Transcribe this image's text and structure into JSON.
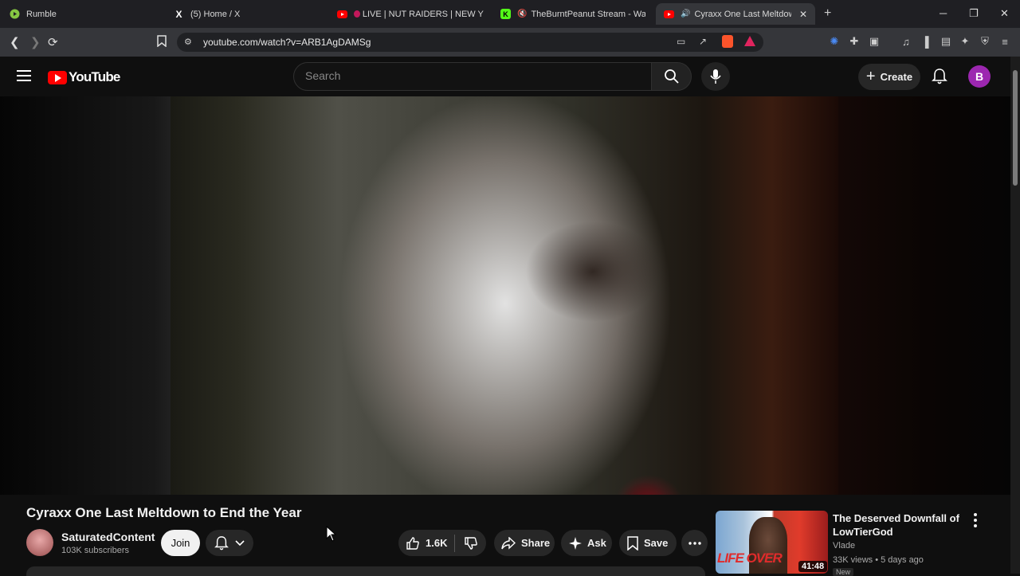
{
  "browser": {
    "tabs": [
      {
        "label": "Rumble",
        "icon": "rumble-icon",
        "color": "#85c742"
      },
      {
        "label": "(5) Home / X",
        "icon": "x-icon",
        "color": "#ffffff"
      },
      {
        "label": "LIVE | NUT RAIDERS | NEW YEAR",
        "icon": "youtube-icon",
        "color": "#ff0000"
      },
      {
        "label": "TheBurntPeanut Stream - Watch",
        "icon": "kick-icon",
        "color": "#53fc18"
      },
      {
        "label": "Cyraxx One Last Meltdown to",
        "icon": "youtube-icon",
        "color": "#ff0000"
      }
    ],
    "url": "youtube.com/watch?v=ARB1AgDAMSg"
  },
  "youtube": {
    "logo_text": "YouTube",
    "search_placeholder": "Search",
    "create_label": "Create",
    "avatar_letter": "B",
    "video": {
      "title": "Cyraxx One Last Meltdown to End the Year",
      "channel_name": "SaturatedContent",
      "subscribers": "103K subscribers",
      "join_label": "Join",
      "likes": "1.6K",
      "share_label": "Share",
      "ask_label": "Ask",
      "save_label": "Save"
    },
    "recommended": [
      {
        "title": "The Deserved Downfall of LowTierGod",
        "channel": "Vlade",
        "meta": "33K views • 5 days ago",
        "duration": "41:48",
        "badge": "New",
        "thumb_text": "LIFE OVER"
      }
    ]
  }
}
